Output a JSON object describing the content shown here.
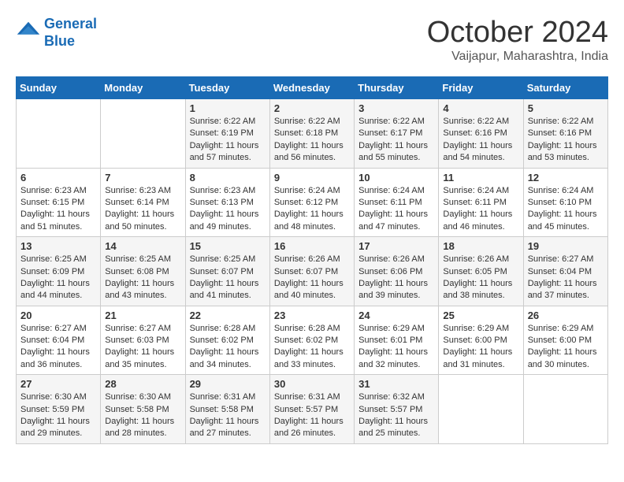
{
  "logo": {
    "line1": "General",
    "line2": "Blue"
  },
  "title": "October 2024",
  "subtitle": "Vaijapur, Maharashtra, India",
  "days_of_week": [
    "Sunday",
    "Monday",
    "Tuesday",
    "Wednesday",
    "Thursday",
    "Friday",
    "Saturday"
  ],
  "weeks": [
    [
      {
        "day": "",
        "sunrise": "",
        "sunset": "",
        "daylight": ""
      },
      {
        "day": "",
        "sunrise": "",
        "sunset": "",
        "daylight": ""
      },
      {
        "day": "1",
        "sunrise": "Sunrise: 6:22 AM",
        "sunset": "Sunset: 6:19 PM",
        "daylight": "Daylight: 11 hours and 57 minutes."
      },
      {
        "day": "2",
        "sunrise": "Sunrise: 6:22 AM",
        "sunset": "Sunset: 6:18 PM",
        "daylight": "Daylight: 11 hours and 56 minutes."
      },
      {
        "day": "3",
        "sunrise": "Sunrise: 6:22 AM",
        "sunset": "Sunset: 6:17 PM",
        "daylight": "Daylight: 11 hours and 55 minutes."
      },
      {
        "day": "4",
        "sunrise": "Sunrise: 6:22 AM",
        "sunset": "Sunset: 6:16 PM",
        "daylight": "Daylight: 11 hours and 54 minutes."
      },
      {
        "day": "5",
        "sunrise": "Sunrise: 6:22 AM",
        "sunset": "Sunset: 6:16 PM",
        "daylight": "Daylight: 11 hours and 53 minutes."
      }
    ],
    [
      {
        "day": "6",
        "sunrise": "Sunrise: 6:23 AM",
        "sunset": "Sunset: 6:15 PM",
        "daylight": "Daylight: 11 hours and 51 minutes."
      },
      {
        "day": "7",
        "sunrise": "Sunrise: 6:23 AM",
        "sunset": "Sunset: 6:14 PM",
        "daylight": "Daylight: 11 hours and 50 minutes."
      },
      {
        "day": "8",
        "sunrise": "Sunrise: 6:23 AM",
        "sunset": "Sunset: 6:13 PM",
        "daylight": "Daylight: 11 hours and 49 minutes."
      },
      {
        "day": "9",
        "sunrise": "Sunrise: 6:24 AM",
        "sunset": "Sunset: 6:12 PM",
        "daylight": "Daylight: 11 hours and 48 minutes."
      },
      {
        "day": "10",
        "sunrise": "Sunrise: 6:24 AM",
        "sunset": "Sunset: 6:11 PM",
        "daylight": "Daylight: 11 hours and 47 minutes."
      },
      {
        "day": "11",
        "sunrise": "Sunrise: 6:24 AM",
        "sunset": "Sunset: 6:11 PM",
        "daylight": "Daylight: 11 hours and 46 minutes."
      },
      {
        "day": "12",
        "sunrise": "Sunrise: 6:24 AM",
        "sunset": "Sunset: 6:10 PM",
        "daylight": "Daylight: 11 hours and 45 minutes."
      }
    ],
    [
      {
        "day": "13",
        "sunrise": "Sunrise: 6:25 AM",
        "sunset": "Sunset: 6:09 PM",
        "daylight": "Daylight: 11 hours and 44 minutes."
      },
      {
        "day": "14",
        "sunrise": "Sunrise: 6:25 AM",
        "sunset": "Sunset: 6:08 PM",
        "daylight": "Daylight: 11 hours and 43 minutes."
      },
      {
        "day": "15",
        "sunrise": "Sunrise: 6:25 AM",
        "sunset": "Sunset: 6:07 PM",
        "daylight": "Daylight: 11 hours and 41 minutes."
      },
      {
        "day": "16",
        "sunrise": "Sunrise: 6:26 AM",
        "sunset": "Sunset: 6:07 PM",
        "daylight": "Daylight: 11 hours and 40 minutes."
      },
      {
        "day": "17",
        "sunrise": "Sunrise: 6:26 AM",
        "sunset": "Sunset: 6:06 PM",
        "daylight": "Daylight: 11 hours and 39 minutes."
      },
      {
        "day": "18",
        "sunrise": "Sunrise: 6:26 AM",
        "sunset": "Sunset: 6:05 PM",
        "daylight": "Daylight: 11 hours and 38 minutes."
      },
      {
        "day": "19",
        "sunrise": "Sunrise: 6:27 AM",
        "sunset": "Sunset: 6:04 PM",
        "daylight": "Daylight: 11 hours and 37 minutes."
      }
    ],
    [
      {
        "day": "20",
        "sunrise": "Sunrise: 6:27 AM",
        "sunset": "Sunset: 6:04 PM",
        "daylight": "Daylight: 11 hours and 36 minutes."
      },
      {
        "day": "21",
        "sunrise": "Sunrise: 6:27 AM",
        "sunset": "Sunset: 6:03 PM",
        "daylight": "Daylight: 11 hours and 35 minutes."
      },
      {
        "day": "22",
        "sunrise": "Sunrise: 6:28 AM",
        "sunset": "Sunset: 6:02 PM",
        "daylight": "Daylight: 11 hours and 34 minutes."
      },
      {
        "day": "23",
        "sunrise": "Sunrise: 6:28 AM",
        "sunset": "Sunset: 6:02 PM",
        "daylight": "Daylight: 11 hours and 33 minutes."
      },
      {
        "day": "24",
        "sunrise": "Sunrise: 6:29 AM",
        "sunset": "Sunset: 6:01 PM",
        "daylight": "Daylight: 11 hours and 32 minutes."
      },
      {
        "day": "25",
        "sunrise": "Sunrise: 6:29 AM",
        "sunset": "Sunset: 6:00 PM",
        "daylight": "Daylight: 11 hours and 31 minutes."
      },
      {
        "day": "26",
        "sunrise": "Sunrise: 6:29 AM",
        "sunset": "Sunset: 6:00 PM",
        "daylight": "Daylight: 11 hours and 30 minutes."
      }
    ],
    [
      {
        "day": "27",
        "sunrise": "Sunrise: 6:30 AM",
        "sunset": "Sunset: 5:59 PM",
        "daylight": "Daylight: 11 hours and 29 minutes."
      },
      {
        "day": "28",
        "sunrise": "Sunrise: 6:30 AM",
        "sunset": "Sunset: 5:58 PM",
        "daylight": "Daylight: 11 hours and 28 minutes."
      },
      {
        "day": "29",
        "sunrise": "Sunrise: 6:31 AM",
        "sunset": "Sunset: 5:58 PM",
        "daylight": "Daylight: 11 hours and 27 minutes."
      },
      {
        "day": "30",
        "sunrise": "Sunrise: 6:31 AM",
        "sunset": "Sunset: 5:57 PM",
        "daylight": "Daylight: 11 hours and 26 minutes."
      },
      {
        "day": "31",
        "sunrise": "Sunrise: 6:32 AM",
        "sunset": "Sunset: 5:57 PM",
        "daylight": "Daylight: 11 hours and 25 minutes."
      },
      {
        "day": "",
        "sunrise": "",
        "sunset": "",
        "daylight": ""
      },
      {
        "day": "",
        "sunrise": "",
        "sunset": "",
        "daylight": ""
      }
    ]
  ]
}
